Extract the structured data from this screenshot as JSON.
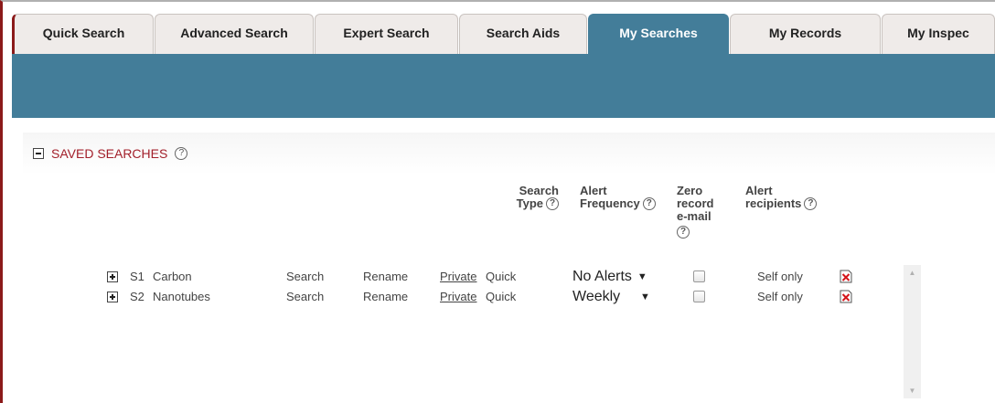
{
  "tabs": [
    {
      "label": "Quick Search",
      "active": false
    },
    {
      "label": "Advanced Search",
      "active": false
    },
    {
      "label": "Expert Search",
      "active": false
    },
    {
      "label": "Search Aids",
      "active": false
    },
    {
      "label": "My Searches",
      "active": true
    },
    {
      "label": "My Records",
      "active": false
    },
    {
      "label": "My Inspec",
      "active": false
    }
  ],
  "section": {
    "title": "SAVED SEARCHES",
    "help": "?"
  },
  "columns": {
    "search_type": [
      "Search",
      "Type"
    ],
    "alert_frequency": [
      "Alert",
      "Frequency"
    ],
    "zero_record": [
      "Zero",
      "record",
      "e-mail"
    ],
    "alert_recipients": [
      "Alert",
      "recipients"
    ],
    "help": "?"
  },
  "rows": [
    {
      "id": "S1",
      "name": "Carbon",
      "search": "Search",
      "rename": "Rename",
      "privacy": "Private",
      "type": "Quick",
      "frequency": "No Alerts",
      "arrow": "▼",
      "recipients": "Self only"
    },
    {
      "id": "S2",
      "name": "Nanotubes",
      "search": "Search",
      "rename": "Rename",
      "privacy": "Private",
      "type": "Quick",
      "frequency": "Weekly",
      "arrow": "▼",
      "recipients": "Self only"
    }
  ],
  "icons": {
    "delete": "delete-icon",
    "expand": "expand-icon",
    "collapse": "collapse-icon",
    "help": "help-icon"
  },
  "colors": {
    "tab_active": "#437d99",
    "banner": "#437d99",
    "accent_red": "#a3202b",
    "tab_bg": "#efebe9"
  }
}
